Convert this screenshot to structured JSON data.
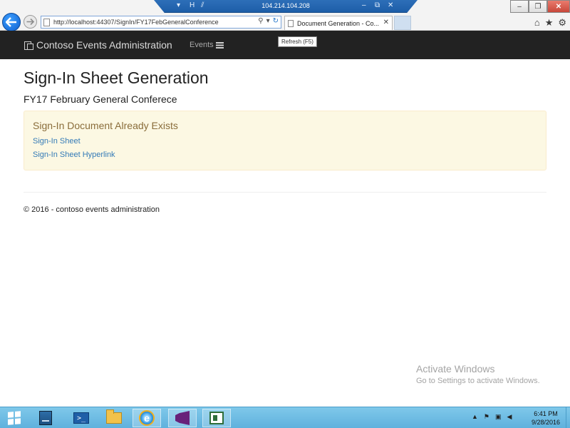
{
  "browser": {
    "rdp_ip": "104.214.104.208",
    "url": "http://localhost:44307/SignIn/FY17FebGeneralConference",
    "tab_title": "Document Generation - Co...",
    "tooltip": "Refresh (F5)"
  },
  "site": {
    "brand": "Contoso Events Administration",
    "nav_events": "Events"
  },
  "page": {
    "title": "Sign-In Sheet Generation",
    "subtitle": "FY17 February General Conferece",
    "alert_heading": "Sign-In Document Already Exists",
    "link_sheet": "Sign-In Sheet",
    "link_hyperlink": "Sign-In Sheet Hyperlink",
    "footer": "© 2016 - contoso events administration"
  },
  "watermark": {
    "title": "Activate Windows",
    "subtitle": "Go to Settings to activate Windows."
  },
  "taskbar": {
    "time": "6:41 PM",
    "date": "9/28/2016"
  },
  "colors": {
    "navbar_bg": "#222222",
    "alert_bg": "#fcf8e3",
    "alert_text": "#8a6d3b",
    "link": "#337ab7",
    "taskbar": "#6bbde4"
  }
}
